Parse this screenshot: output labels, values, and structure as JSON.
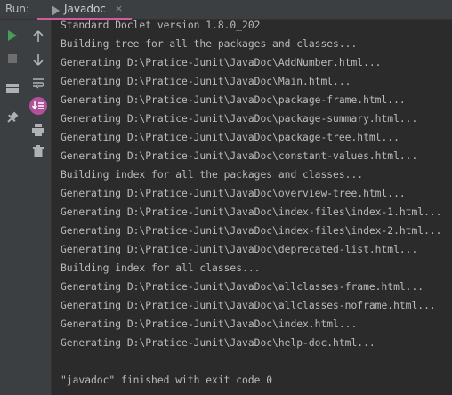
{
  "header": {
    "run_label": "Run:",
    "tab_title": "Javadoc",
    "tab_close": "×"
  },
  "colors": {
    "run_green": "#499c54",
    "accent_pink": "#d25b9c",
    "console_bg": "#2b2b2b",
    "toolbar_bg": "#3c3f41",
    "text": "#bbbbbb"
  },
  "toolbar_left": [
    {
      "icon": "run-icon"
    },
    {
      "icon": "stop-icon"
    },
    {
      "icon": "layout-icon"
    },
    {
      "icon": "pin-icon"
    }
  ],
  "toolbar_right": [
    {
      "icon": "arrow-up-icon"
    },
    {
      "icon": "arrow-down-icon"
    },
    {
      "icon": "soft-wrap-icon"
    },
    {
      "icon": "scroll-to-end-icon"
    },
    {
      "icon": "print-icon"
    },
    {
      "icon": "trash-icon"
    }
  ],
  "console": {
    "lines": [
      "Standard Doclet version 1.8.0_202",
      "Building tree for all the packages and classes...",
      "Generating D:\\Pratice-Junit\\JavaDoc\\AddNumber.html...",
      "Generating D:\\Pratice-Junit\\JavaDoc\\Main.html...",
      "Generating D:\\Pratice-Junit\\JavaDoc\\package-frame.html...",
      "Generating D:\\Pratice-Junit\\JavaDoc\\package-summary.html...",
      "Generating D:\\Pratice-Junit\\JavaDoc\\package-tree.html...",
      "Generating D:\\Pratice-Junit\\JavaDoc\\constant-values.html...",
      "Building index for all the packages and classes...",
      "Generating D:\\Pratice-Junit\\JavaDoc\\overview-tree.html...",
      "Generating D:\\Pratice-Junit\\JavaDoc\\index-files\\index-1.html...",
      "Generating D:\\Pratice-Junit\\JavaDoc\\index-files\\index-2.html...",
      "Generating D:\\Pratice-Junit\\JavaDoc\\deprecated-list.html...",
      "Building index for all classes...",
      "Generating D:\\Pratice-Junit\\JavaDoc\\allclasses-frame.html...",
      "Generating D:\\Pratice-Junit\\JavaDoc\\allclasses-noframe.html...",
      "Generating D:\\Pratice-Junit\\JavaDoc\\index.html...",
      "Generating D:\\Pratice-Junit\\JavaDoc\\help-doc.html...",
      "",
      "\"javadoc\" finished with exit code 0"
    ]
  }
}
